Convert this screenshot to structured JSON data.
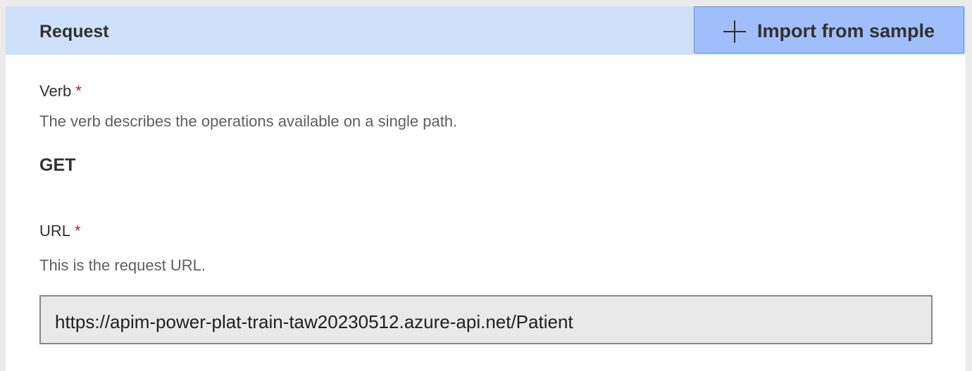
{
  "header": {
    "title": "Request",
    "import_button_label": "Import from sample",
    "import_icon": "plus-icon"
  },
  "verb": {
    "label": "Verb",
    "required_marker": "*",
    "description": "The verb describes the operations available on a single path.",
    "value": "GET"
  },
  "url": {
    "label": "URL",
    "required_marker": "*",
    "description": "This is the request URL.",
    "value": "https://apim-power-plat-train-taw20230512.azure-api.net/Patient"
  },
  "colors": {
    "header_bg": "#cfe0fa",
    "button_bg": "#a0befa",
    "required": "#a4262c"
  }
}
